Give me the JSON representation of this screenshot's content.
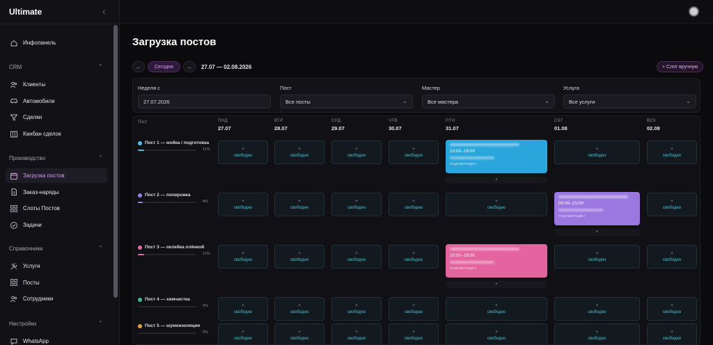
{
  "app": {
    "title": "Ultimate"
  },
  "sidebar": {
    "top_item": {
      "label": "Инфопанель",
      "icon": "home-icon"
    },
    "sections": [
      {
        "title": "CRM",
        "items": [
          {
            "label": "Клиенты",
            "icon": "users-icon"
          },
          {
            "label": "Автомобили",
            "icon": "car-icon"
          },
          {
            "label": "Сделки",
            "icon": "filter-icon"
          },
          {
            "label": "Канбан сделок",
            "icon": "kanban-icon"
          }
        ]
      },
      {
        "title": "Производство",
        "items": [
          {
            "label": "Загрузка постов",
            "icon": "calendar-icon",
            "active": true
          },
          {
            "label": "Заказ-наряды",
            "icon": "document-icon"
          },
          {
            "label": "Слоты Постов",
            "icon": "grid-icon"
          },
          {
            "label": "Задачи",
            "icon": "check-circle-icon"
          }
        ]
      },
      {
        "title": "Справочники",
        "items": [
          {
            "label": "Услуги",
            "icon": "wrench-icon"
          },
          {
            "label": "Посты",
            "icon": "grid-icon"
          },
          {
            "label": "Сотрудники",
            "icon": "users-icon"
          }
        ]
      },
      {
        "title": "Настройки",
        "items": [
          {
            "label": "WhatsApp",
            "icon": "chat-icon"
          }
        ]
      }
    ]
  },
  "header": {
    "title": "Загрузка постов",
    "prev": "←",
    "next": "→",
    "today": "Сегодня",
    "range": "27.07 — 02.08.2026",
    "manual_slot": "+ Слот вручную"
  },
  "filters": {
    "week": {
      "label": "Неделя с",
      "value": "27.07.2026"
    },
    "post": {
      "label": "Пост",
      "value": "Все посты"
    },
    "master": {
      "label": "Мастер",
      "value": "Все мастера"
    },
    "service": {
      "label": "Услуга",
      "value": "Все услуги"
    }
  },
  "grid": {
    "post_header": "Пост",
    "days": [
      {
        "dow": "ПНД",
        "date": "27.07"
      },
      {
        "dow": "ВТР",
        "date": "28.07"
      },
      {
        "dow": "СРД",
        "date": "29.07"
      },
      {
        "dow": "ЧТВ",
        "date": "30.07"
      },
      {
        "dow": "ПТН",
        "date": "31.07"
      },
      {
        "dow": "СБТ",
        "date": "01.08"
      },
      {
        "dow": "ВСК",
        "date": "02.08"
      }
    ],
    "free_label": "свободно",
    "plus": "+",
    "posts": [
      {
        "name": "Пост 1 — мойка / подготовка",
        "pct": "11%",
        "load": 0.11,
        "color": "#4fc3d9"
      },
      {
        "name": "Пост 2 — полировка",
        "pct": "8%",
        "load": 0.08,
        "color": "#9b7fe0"
      },
      {
        "name": "Пост 3 — оклейка плёнкой",
        "pct": "11%",
        "load": 0.11,
        "color": "#e56aa6"
      },
      {
        "name": "Пост 4 — химчистка",
        "pct": "0%",
        "load": 0,
        "color": "#3fb98a"
      },
      {
        "name": "Пост 5 — шумоизоляция",
        "pct": "0%",
        "load": 0,
        "color": "#e0a23c"
      }
    ],
    "bookings": [
      {
        "row": 0,
        "day": 4,
        "time": "10:00–18:00",
        "status": "ПОДТВЕРЖДЁН",
        "color": "#2aa6dc"
      },
      {
        "row": 1,
        "day": 5,
        "time": "09:00–15:00",
        "status": "ПОДТВЕРЖДЁН",
        "color": "#9a78e0"
      },
      {
        "row": 2,
        "day": 4,
        "time": "10:00–18:00",
        "status": "ПОДТВЕРЖДЁН",
        "color": "#e4649f"
      }
    ]
  }
}
